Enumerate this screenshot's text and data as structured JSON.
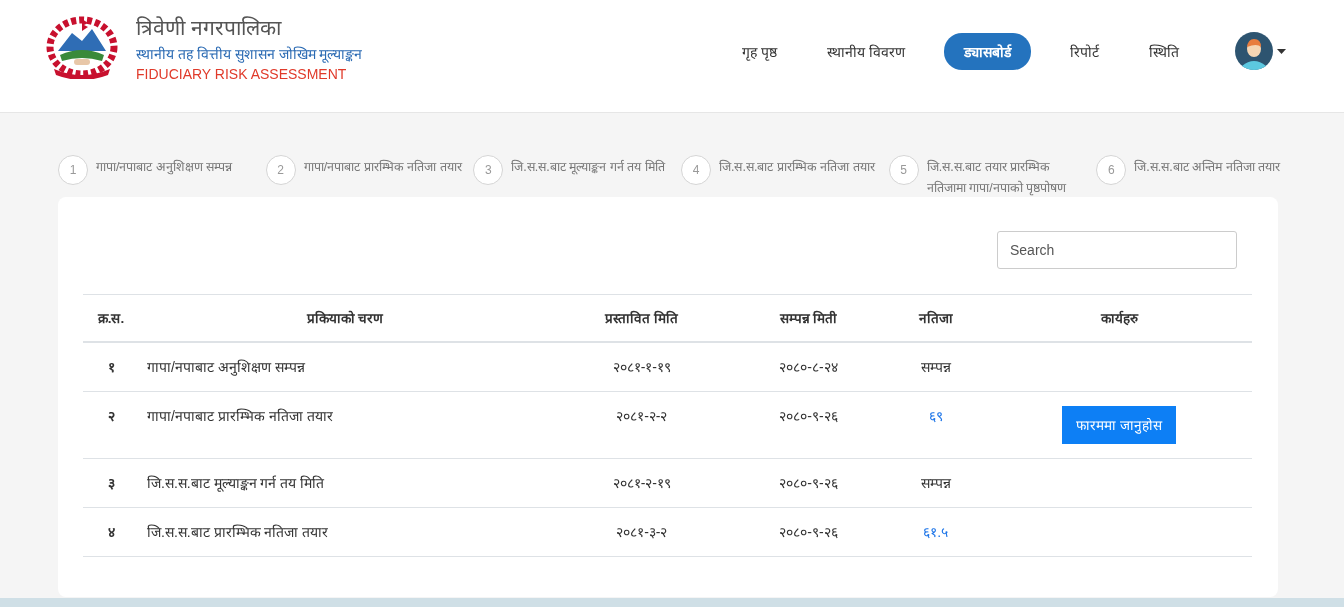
{
  "header": {
    "title": "त्रिवेणी नगरपालिका",
    "subtitle": "स्थानीय तह वित्तीय सुशासन जोखिम मूल्याङ्कन",
    "tagline": "FIDUCIARY RISK ASSESSMENT"
  },
  "nav": [
    {
      "label": "गृह पृष्ठ",
      "selected": false
    },
    {
      "label": "स्थानीय विवरण",
      "selected": false
    },
    {
      "label": "ड्यासबोर्ड",
      "selected": true
    },
    {
      "label": "रिपोर्ट",
      "selected": false
    },
    {
      "label": "स्थिति",
      "selected": false
    }
  ],
  "steps": [
    {
      "number": "1",
      "label": "गापा/नपाबाट अनुशिक्षण सम्पन्न"
    },
    {
      "number": "2",
      "label": "गापा/नपाबाट प्रारम्भिक नतिजा तयार"
    },
    {
      "number": "3",
      "label": "जि.स.स.बाट मूल्याङ्कन गर्न तय मिति"
    },
    {
      "number": "4",
      "label": "जि.स.स.बाट प्रारम्भिक नतिजा तयार"
    },
    {
      "number": "5",
      "label": "जि.स.स.बाट तयार प्रारम्भिक नतिजामा गापा/नपाको पृष्ठपोषण"
    },
    {
      "number": "6",
      "label": "जि.स.स.बाट अन्तिम नतिजा तयार"
    }
  ],
  "search": {
    "placeholder": "Search"
  },
  "table": {
    "columns": [
      "क्र.स.",
      "प्रकियाको चरण",
      "प्रस्तावित मिति",
      "सम्पन्न मिती",
      "नतिजा",
      "कार्यहरु"
    ],
    "rows": [
      {
        "sn": "१",
        "stage": "गापा/नपाबाट अनुशिक्षण सम्पन्न",
        "proposed": "२०८१-१-१९",
        "completed": "२०८०-८-२४",
        "result": {
          "kind": "text",
          "text": "सम्पन्न"
        }
      },
      {
        "sn": "२",
        "stage": "गापा/नपाबाट प्रारम्भिक नतिजा तयार",
        "proposed": "२०८१-२-२",
        "completed": "२०८०-९-२६",
        "result": {
          "kind": "link",
          "text": "६९"
        },
        "action": "फारममा जानुहोस"
      },
      {
        "sn": "३",
        "stage": "जि.स.स.बाट मूल्याङ्कन गर्न तय मिति",
        "proposed": "२०८१-२-१९",
        "completed": "२०८०-९-२६",
        "result": {
          "kind": "text",
          "text": "सम्पन्न"
        }
      },
      {
        "sn": "४",
        "stage": "जि.स.स.बाट प्रारम्भिक नतिजा तयार",
        "proposed": "२०८१-३-२",
        "completed": "२०८०-९-२६",
        "result": {
          "kind": "link",
          "text": "६१.५"
        }
      }
    ]
  }
}
